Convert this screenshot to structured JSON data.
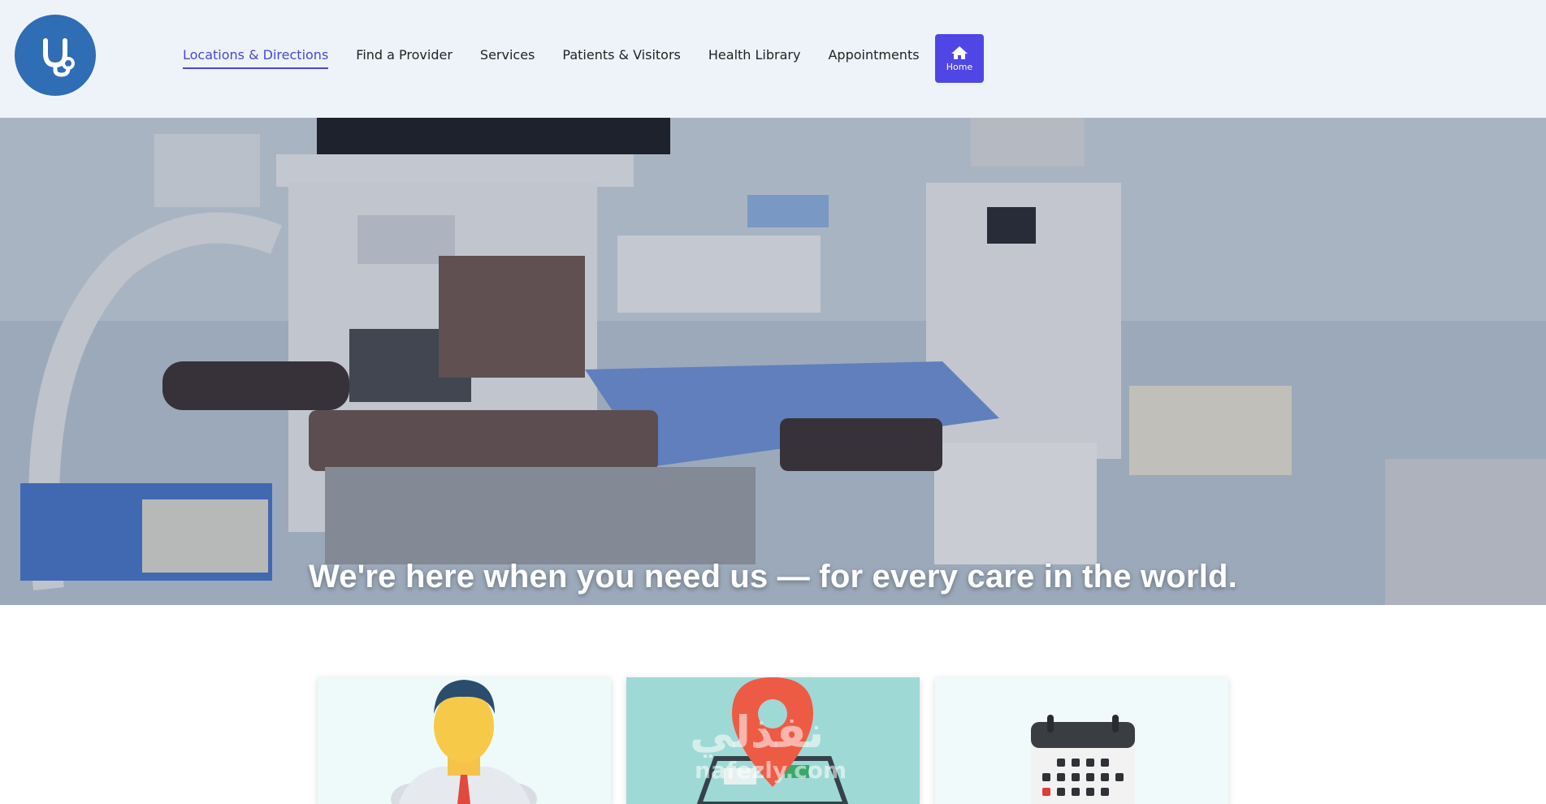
{
  "header": {
    "logo_icon": "stethoscope-logo-icon",
    "nav": [
      {
        "label": "Locations & Directions",
        "active": true
      },
      {
        "label": "Find a Provider",
        "active": false
      },
      {
        "label": "Services",
        "active": false
      },
      {
        "label": "Patients & Visitors",
        "active": false
      },
      {
        "label": "Health Library",
        "active": false
      },
      {
        "label": "Appointments",
        "active": false
      }
    ],
    "home_button": {
      "label": "Home",
      "icon": "home-icon"
    }
  },
  "hero": {
    "title": "We're here when you need us — for every care in the world.",
    "image": "operating-room-photo"
  },
  "cards": [
    {
      "image": "doctor-illustration"
    },
    {
      "image": "location-pin-map-illustration",
      "watermark_ar": "نفذلي",
      "watermark_en": "nafezly.com"
    },
    {
      "image": "calendar-illustration"
    }
  ],
  "colors": {
    "header_bg": "#eef3f9",
    "accent": "#5046e5",
    "logo_bg": "#2f6db5",
    "active_link": "#4b46d8"
  }
}
